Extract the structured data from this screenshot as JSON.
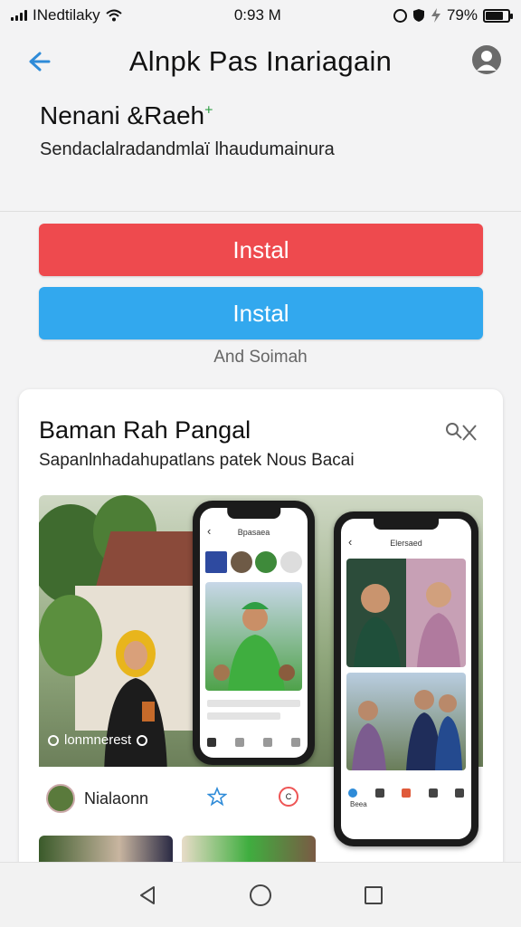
{
  "status_bar": {
    "carrier": "INedtilaky",
    "time": "0:93 M",
    "battery": "79%",
    "battery_level": 0.79
  },
  "app_bar": {
    "title": "Alnpk Pas Inariagain"
  },
  "header": {
    "title": "Nenani &Raeh",
    "title_mark": "+",
    "subtitle": "Sendaclalradandmlaї lhaudumainura"
  },
  "actions": {
    "install_red": "Instal",
    "install_blue": "Instal",
    "secondary_text": "And Soimah"
  },
  "card": {
    "title": "Baman Rah Pangal",
    "subtitle": "Sapanlnhadahupatlans patek Nous Bacai",
    "photo_caption": "lonmnerest",
    "phone1_header": "Bpasaea",
    "phone2_header": "Elersaed",
    "phone2_label": "Beea",
    "profile_name": "Nialaonn"
  },
  "colors": {
    "red_button": "#ee4a4e",
    "blue_button": "#32a8ee",
    "accent_blue": "#2e8bd8"
  }
}
